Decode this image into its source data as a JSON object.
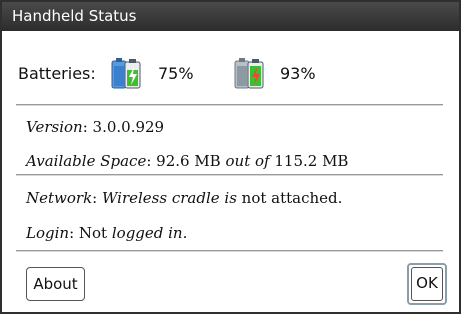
{
  "window": {
    "title": "Handheld Status"
  },
  "batteries": {
    "label": "Batteries:",
    "items": [
      {
        "percent_text": "75%",
        "level": 0.75,
        "icon": "battery-with-adapter-icon"
      },
      {
        "percent_text": "93%",
        "level": 0.93,
        "icon": "battery-icon"
      }
    ]
  },
  "info": {
    "version_label": "Version",
    "version_value": "3.0.0.929",
    "space_label": "Available Space",
    "space_value": "92.6 MB",
    "space_out_of": "out of",
    "space_total": "115.2 MB",
    "network_label": "Network",
    "network_status_italic": "Wireless cradle is",
    "network_status": "not attached.",
    "login_label": "Login",
    "login_value_plain": "Not",
    "login_value_italic": "logged in."
  },
  "buttons": {
    "about": "About",
    "ok": "OK"
  },
  "colors": {
    "titlebar": "#333333",
    "battery_green": "#3fbf2f",
    "battery_blue": "#3a7fd0",
    "battery_gray": "#8d9aa3",
    "ok_focus": "#8a9da8"
  }
}
